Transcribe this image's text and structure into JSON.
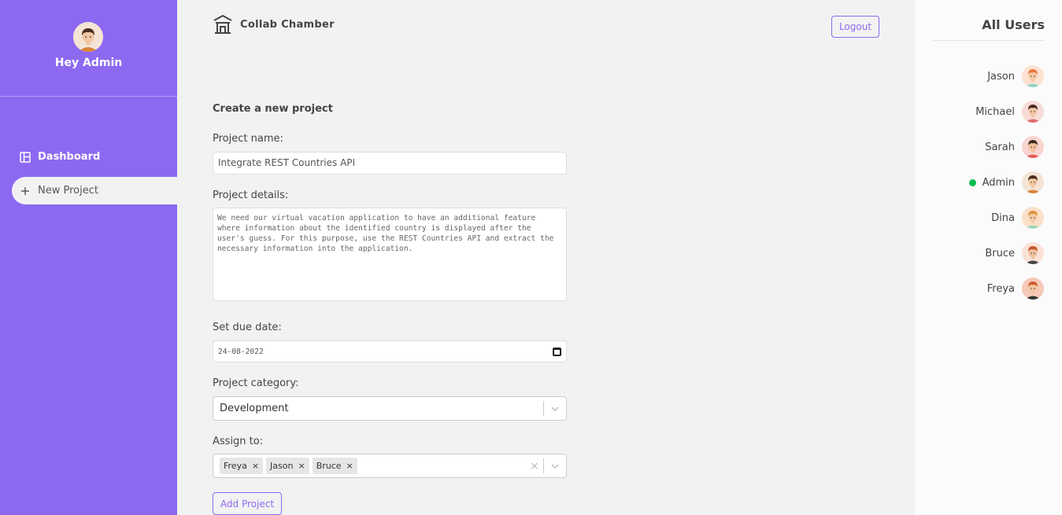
{
  "sidebar": {
    "greeting": "Hey Admin",
    "avatar": {
      "skin": "#f2c7a2",
      "hair": "#4a2e1e",
      "shirt": "#d9843a",
      "bg": "#f3e4d6"
    },
    "items": [
      {
        "label": "Dashboard",
        "icon": "dashboard-icon",
        "active": false
      },
      {
        "label": "New Project",
        "icon": "plus-icon",
        "active": true
      }
    ]
  },
  "header": {
    "app_name": "Collab Chamber",
    "logout_label": "Logout"
  },
  "form": {
    "title": "Create a new project",
    "name_label": "Project name:",
    "name_value": "Integrate REST Countries API",
    "details_label": "Project details:",
    "details_value": "We need our virtual vacation application to have an additional feature where information about the identified country is displayed after the user's guess. For this purpose, use the REST Countries API and extract the necessary information into the application.",
    "due_label": "Set due date:",
    "due_value": "24-08-2022",
    "category_label": "Project category:",
    "category_value": "Development",
    "assign_label": "Assign to:",
    "assigned": [
      "Freya",
      "Jason",
      "Bruce"
    ],
    "submit_label": "Add Project"
  },
  "users_panel": {
    "title": "All Users",
    "users": [
      {
        "name": "Jason",
        "online": false,
        "skin": "#f6c9a4",
        "hair": "#e8773f",
        "shirt": "#8fd3c7",
        "bg": "#fde2d2"
      },
      {
        "name": "Michael",
        "online": false,
        "skin": "#f3c6a5",
        "hair": "#4b2b1c",
        "shirt": "#e06a6a",
        "bg": "#f7dcd6"
      },
      {
        "name": "Sarah",
        "online": false,
        "skin": "#f1c19c",
        "hair": "#3a2a22",
        "shirt": "#e45a5a",
        "bg": "#f9d5d0"
      },
      {
        "name": "Admin",
        "online": true,
        "skin": "#f2c7a2",
        "hair": "#4a2e1e",
        "shirt": "#d9843a",
        "bg": "#f3e4d6"
      },
      {
        "name": "Dina",
        "online": false,
        "skin": "#f6cba7",
        "hair": "#e0913f",
        "shirt": "#9fd8b8",
        "bg": "#fbe0c9"
      },
      {
        "name": "Bruce",
        "online": false,
        "skin": "#f0c09e",
        "hair": "#c9572d",
        "shirt": "#444444",
        "bg": "#fbe2d7"
      },
      {
        "name": "Freya",
        "online": false,
        "skin": "#f4c4a0",
        "hair": "#d0582e",
        "shirt": "#333333",
        "bg": "#f6c9b8"
      }
    ]
  }
}
